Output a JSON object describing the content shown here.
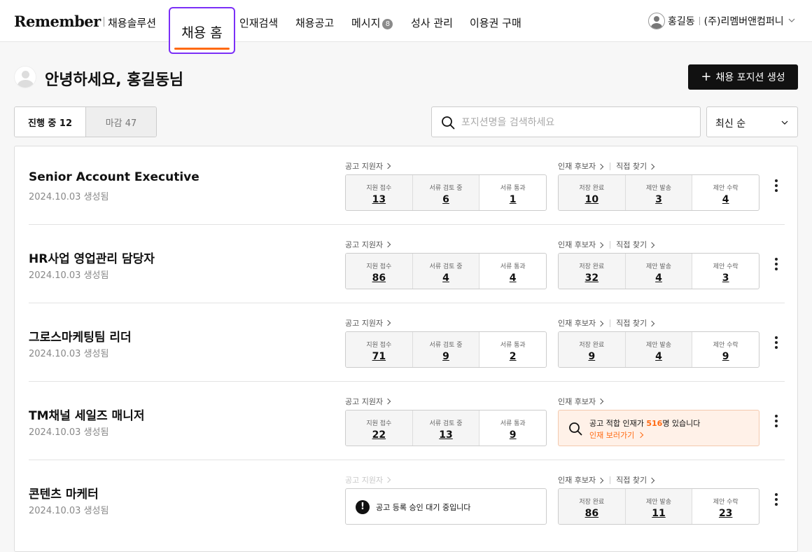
{
  "header": {
    "logo": "Remember",
    "logo_sub": "채용솔루션",
    "nav": [
      {
        "label": "채용 홈"
      },
      {
        "label": "인재검색"
      },
      {
        "label": "채용공고"
      },
      {
        "label": "메시지",
        "badge": "8"
      },
      {
        "label": "성사 관리"
      },
      {
        "label": "이용권 구매"
      }
    ],
    "user_name": "홍길동",
    "company": "(주)리멤버앤컴퍼니"
  },
  "greeting": {
    "title": "안녕하세요, 홍길동님",
    "create_button": "채용 포지션 생성"
  },
  "tabs": [
    {
      "label": "진행 중 12",
      "active": true
    },
    {
      "label": "마감 47",
      "active": false
    }
  ],
  "search": {
    "placeholder": "포지션명을 검색하세요",
    "value": ""
  },
  "sort": {
    "label": "최신 순"
  },
  "labels": {
    "applicants": "공고 지원자",
    "talent": "인재 후보자",
    "direct": "직접 찾기",
    "received": "지원 접수",
    "reviewing": "서류 검토 중",
    "passed": "서류 통과",
    "saved": "저장 완료",
    "offered": "제안 발송",
    "accepted": "제안 수락"
  },
  "positions": [
    {
      "title": "Senior Account Executive",
      "created": "2024.10.03 생성됨",
      "received": "13",
      "reviewing": "6",
      "passed": "1",
      "saved": "10",
      "offered": "3",
      "accepted": "4"
    },
    {
      "title": "HR사업 영업관리 담당자",
      "created": "2024.10.03 생성됨",
      "received": "86",
      "reviewing": "4",
      "passed": "4",
      "saved": "32",
      "offered": "4",
      "accepted": "3"
    },
    {
      "title": "그로스마케팅팀 리더",
      "created": "2024.10.03 생성됨",
      "received": "71",
      "reviewing": "9",
      "passed": "2",
      "saved": "9",
      "offered": "4",
      "accepted": "9"
    },
    {
      "title": "TM채널 세일즈 매니저",
      "created": "2024.10.03 생성됨",
      "received": "22",
      "reviewing": "13",
      "passed": "9",
      "talent_notice_pre": "공고 적합 인재가 ",
      "talent_notice_count": "516",
      "talent_notice_post": "명 있습니다",
      "talent_link": "인재 보러가기"
    },
    {
      "title": "콘텐츠 마케터",
      "created": "2024.10.03 생성됨",
      "pending_notice": "공고 등록 승인 대기 중입니다",
      "saved": "86",
      "offered": "11",
      "accepted": "23"
    }
  ],
  "colors": {
    "accent": "#ff6a13",
    "focus_outline": "#7b2ff7",
    "primary_button": "#111111"
  }
}
